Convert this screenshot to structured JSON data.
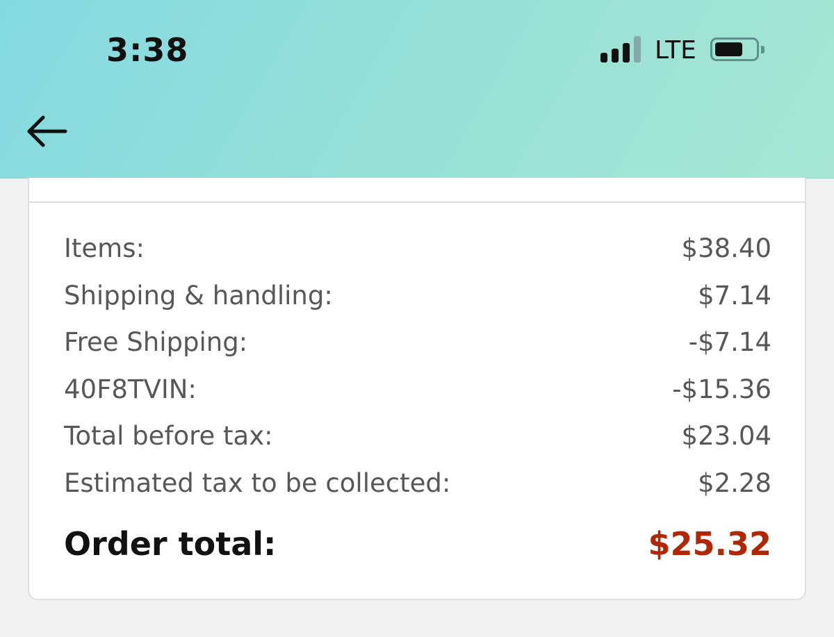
{
  "status_bar": {
    "time": "3:38",
    "network": "LTE",
    "signal_bars": 4,
    "signal_bars_active": 3,
    "battery_level": 0.7
  },
  "nav": {
    "back_icon": "arrow-left-icon"
  },
  "summary": {
    "rows": [
      {
        "label": "Items:",
        "value": "$38.40"
      },
      {
        "label": "Shipping & handling:",
        "value": "$7.14"
      },
      {
        "label": "Free Shipping:",
        "value": "-$7.14"
      },
      {
        "label": "40F8TVIN:",
        "value": "-$15.36"
      },
      {
        "label": "Total before tax:",
        "value": "$23.04"
      },
      {
        "label": "Estimated tax to be collected:",
        "value": "$2.28"
      }
    ],
    "total": {
      "label": "Order total:",
      "value": "$25.32"
    }
  },
  "colors": {
    "header_gradient_start": "#84d9e1",
    "header_gradient_end": "#a6e6d2",
    "total_price": "#b12704",
    "page_background": "#f2f2f2"
  }
}
